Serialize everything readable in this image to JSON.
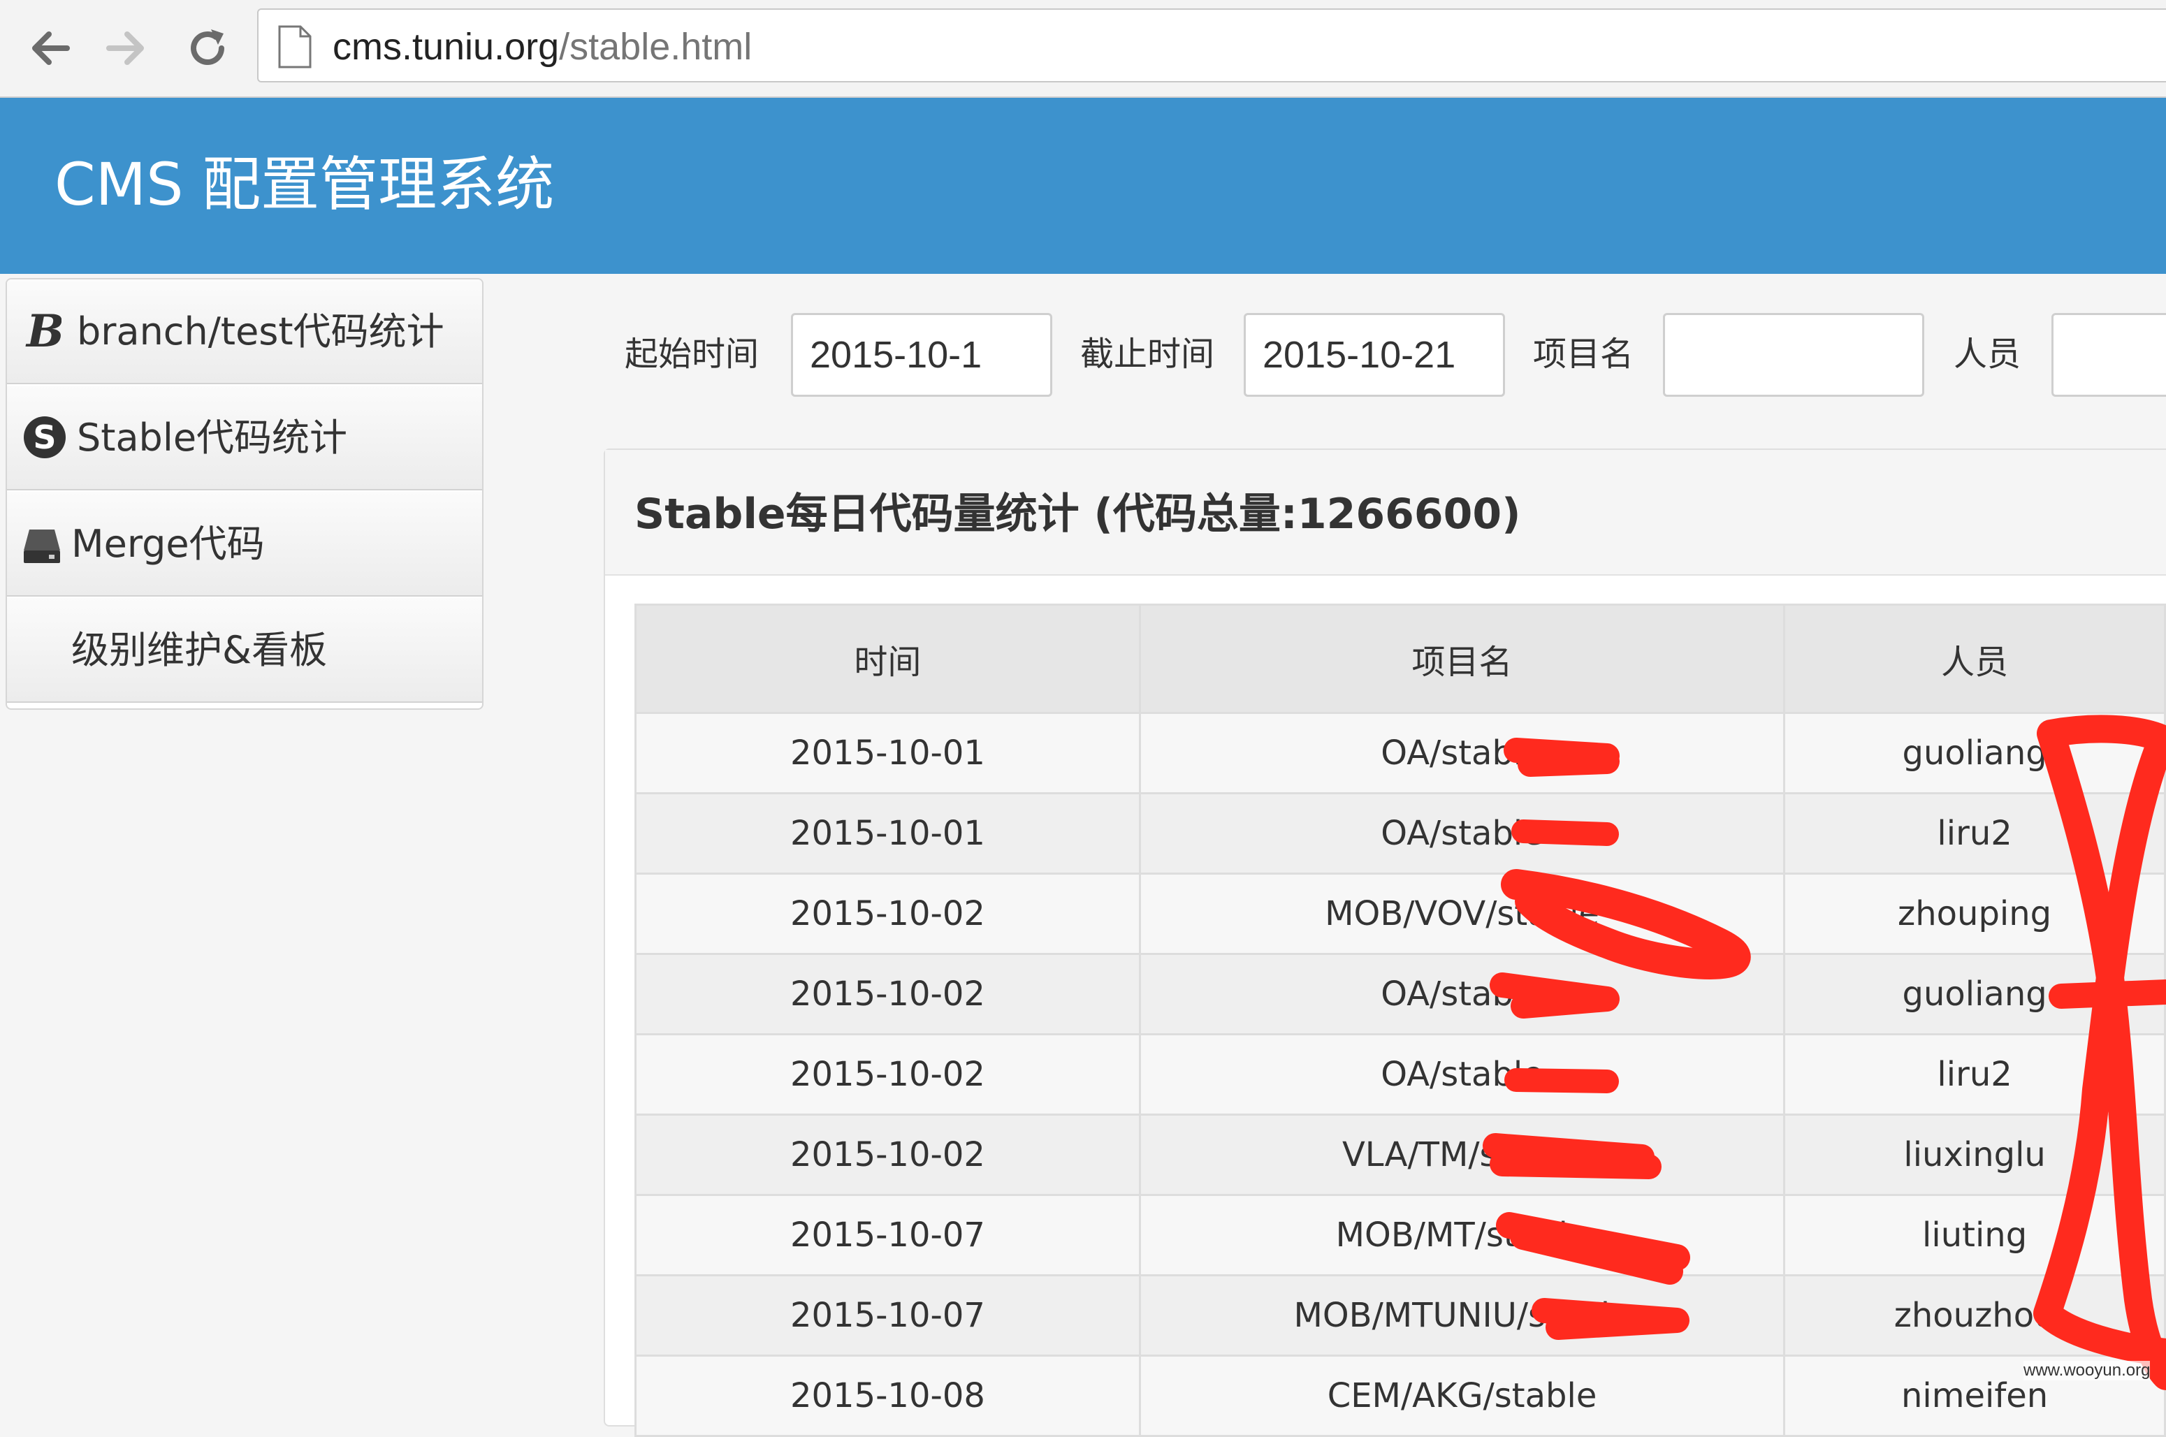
{
  "browser": {
    "url_host": "cms.tuniu.org",
    "url_path": "/stable.html",
    "back_icon": "back-arrow-icon",
    "forward_icon": "forward-arrow-icon",
    "reload_icon": "reload-icon",
    "page_icon": "page-icon"
  },
  "header": {
    "title": "CMS 配置管理系统",
    "color": "#3d92cd"
  },
  "sidebar": {
    "items": [
      {
        "label": "branch/test代码统计",
        "icon": "bold-b-icon"
      },
      {
        "label": "Stable代码统计",
        "icon": "skype-s-icon"
      },
      {
        "label": "Merge代码",
        "icon": "drive-icon"
      },
      {
        "label": "级别维护&看板",
        "icon": ""
      }
    ]
  },
  "filters": {
    "start_label": "起始时间",
    "start_value": "2015-10-1",
    "end_label": "截止时间",
    "end_value": "2015-10-21",
    "project_label": "项目名",
    "project_value": "",
    "person_label": "人员",
    "person_value": ""
  },
  "panel": {
    "title": "Stable每日代码量统计 (代码总量:1266600)"
  },
  "table": {
    "headers": [
      "时间",
      "项目名",
      "人员"
    ],
    "rows": [
      [
        "2015-10-01",
        "OA/stable",
        "guoliang"
      ],
      [
        "2015-10-01",
        "OA/stable",
        "liru2"
      ],
      [
        "2015-10-02",
        "MOB/VOV/stable",
        "zhouping"
      ],
      [
        "2015-10-02",
        "OA/stable",
        "guoliang"
      ],
      [
        "2015-10-02",
        "OA/stable",
        "liru2"
      ],
      [
        "2015-10-02",
        "VLA/TM/stable",
        "liuxinglu"
      ],
      [
        "2015-10-07",
        "MOB/MT/stable",
        "liuting"
      ],
      [
        "2015-10-07",
        "MOB/MTUNIU/stable",
        "zhouzhou"
      ],
      [
        "2015-10-08",
        "CEM/AKG/stable",
        "nimeifen"
      ]
    ]
  },
  "watermark": "www.wooyun.org",
  "colors": {
    "redaction": "#ff2a1e"
  }
}
